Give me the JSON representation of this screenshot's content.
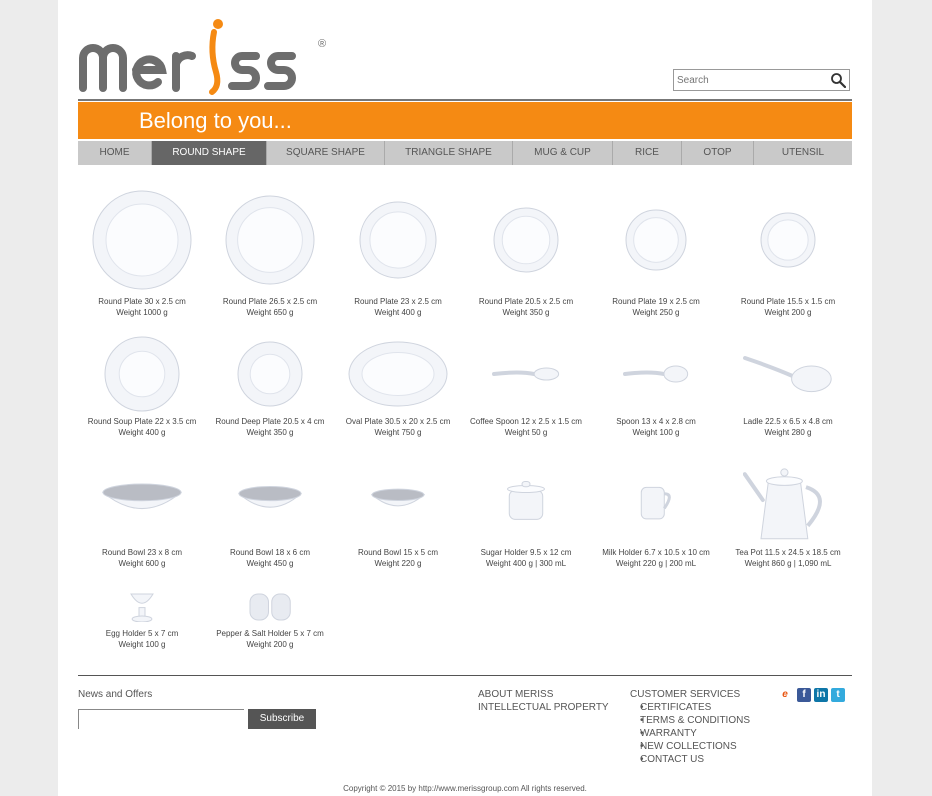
{
  "brand": {
    "name": "meriss",
    "registered": "®",
    "tagline": "Belong to you..."
  },
  "search": {
    "placeholder": "Search"
  },
  "nav": {
    "items": [
      {
        "label": "HOME",
        "active": false
      },
      {
        "label": "ROUND SHAPE",
        "active": true
      },
      {
        "label": "SQUARE SHAPE",
        "active": false
      },
      {
        "label": "TRIANGLE SHAPE",
        "active": false
      },
      {
        "label": "MUG & CUP",
        "active": false
      },
      {
        "label": "RICE",
        "active": false
      },
      {
        "label": "OTOP",
        "active": false
      },
      {
        "label": "UTENSIL",
        "active": false
      }
    ]
  },
  "products": [
    {
      "name": "Round Plate 30 x 2.5 cm",
      "weight": "Weight 1000 g",
      "icon": "plate-icon"
    },
    {
      "name": "Round Plate 26.5 x 2.5 cm",
      "weight": "Weight 650 g",
      "icon": "plate-icon"
    },
    {
      "name": "Round Plate 23 x 2.5 cm",
      "weight": "Weight 400 g",
      "icon": "plate-icon"
    },
    {
      "name": "Round Plate 20.5 x 2.5 cm",
      "weight": "Weight 350 g",
      "icon": "plate-icon"
    },
    {
      "name": "Round Plate 19 x 2.5 cm",
      "weight": "Weight 250 g",
      "icon": "plate-icon"
    },
    {
      "name": "Round Plate 15.5 x 1.5 cm",
      "weight": "Weight 200 g",
      "icon": "plate-icon"
    },
    {
      "name": "Round Soup Plate 22 x 3.5 cm",
      "weight": "Weight 400 g",
      "icon": "soup-plate-icon"
    },
    {
      "name": "Round Deep Plate 20.5 x 4 cm",
      "weight": "Weight 350 g",
      "icon": "deep-plate-icon"
    },
    {
      "name": "Oval Plate 30.5 x 20 x 2.5 cm",
      "weight": "Weight 750 g",
      "icon": "oval-plate-icon"
    },
    {
      "name": "Coffee Spoon 12 x 2.5 x 1.5 cm",
      "weight": "Weight 50 g",
      "icon": "coffee-spoon-icon"
    },
    {
      "name": "Spoon 13 x 4 x 2.8 cm",
      "weight": "Weight 100 g",
      "icon": "spoon-icon"
    },
    {
      "name": "Ladle 22.5 x 6.5 x 4.8 cm",
      "weight": "Weight 280 g",
      "icon": "ladle-icon"
    },
    {
      "name": "Round Bowl 23 x 8 cm",
      "weight": "Weight 600 g",
      "icon": "bowl-icon"
    },
    {
      "name": "Round Bowl 18 x 6 cm",
      "weight": "Weight 450 g",
      "icon": "bowl-icon"
    },
    {
      "name": "Round Bowl 15 x 5 cm",
      "weight": "Weight 220 g",
      "icon": "bowl-icon"
    },
    {
      "name": "Sugar Holder 9.5 x 12 cm",
      "weight": "Weight 400 g | 300 mL",
      "icon": "sugar-holder-icon"
    },
    {
      "name": "Milk Holder 6.7 x 10.5 x 10 cm",
      "weight": "Weight 220 g | 200 mL",
      "icon": "milk-holder-icon"
    },
    {
      "name": "Tea Pot 11.5 x 24.5 x 18.5 cm",
      "weight": "Weight 860 g | 1,090 mL",
      "icon": "tea-pot-icon"
    },
    {
      "name": "Egg Holder 5 x 7 cm",
      "weight": "Weight 100 g",
      "icon": "egg-holder-icon"
    },
    {
      "name": "Pepper & Salt Holder 5 x 7 cm",
      "weight": "Weight 200 g",
      "icon": "pepper-salt-icon"
    }
  ],
  "footer": {
    "news_label": "News and Offers",
    "subscribe_label": "Subscribe",
    "links": [
      "ABOUT MERISS",
      "INTELLECTUAL PROPERTY"
    ],
    "customer_services": {
      "title": "CUSTOMER SERVICES",
      "items": [
        "CERTIFICATES",
        "TERMS & CONDITIONS",
        "WARRANTY",
        "NEW COLLECTIONS",
        "CONTACT US"
      ]
    },
    "social": [
      {
        "icon": "alibaba-icon",
        "color": "#e8540f"
      },
      {
        "icon": "facebook-icon",
        "color": "#3b5998"
      },
      {
        "icon": "linkedin-icon",
        "color": "#0e76a8"
      },
      {
        "icon": "twitter-icon",
        "color": "#33aadd"
      }
    ],
    "copyright": "Copyright © 2015 by http://www.merissgroup.com All rights reserved."
  },
  "colors": {
    "accent": "#f58a13",
    "nav_bg": "#c9c9c9",
    "nav_active": "#666666"
  }
}
